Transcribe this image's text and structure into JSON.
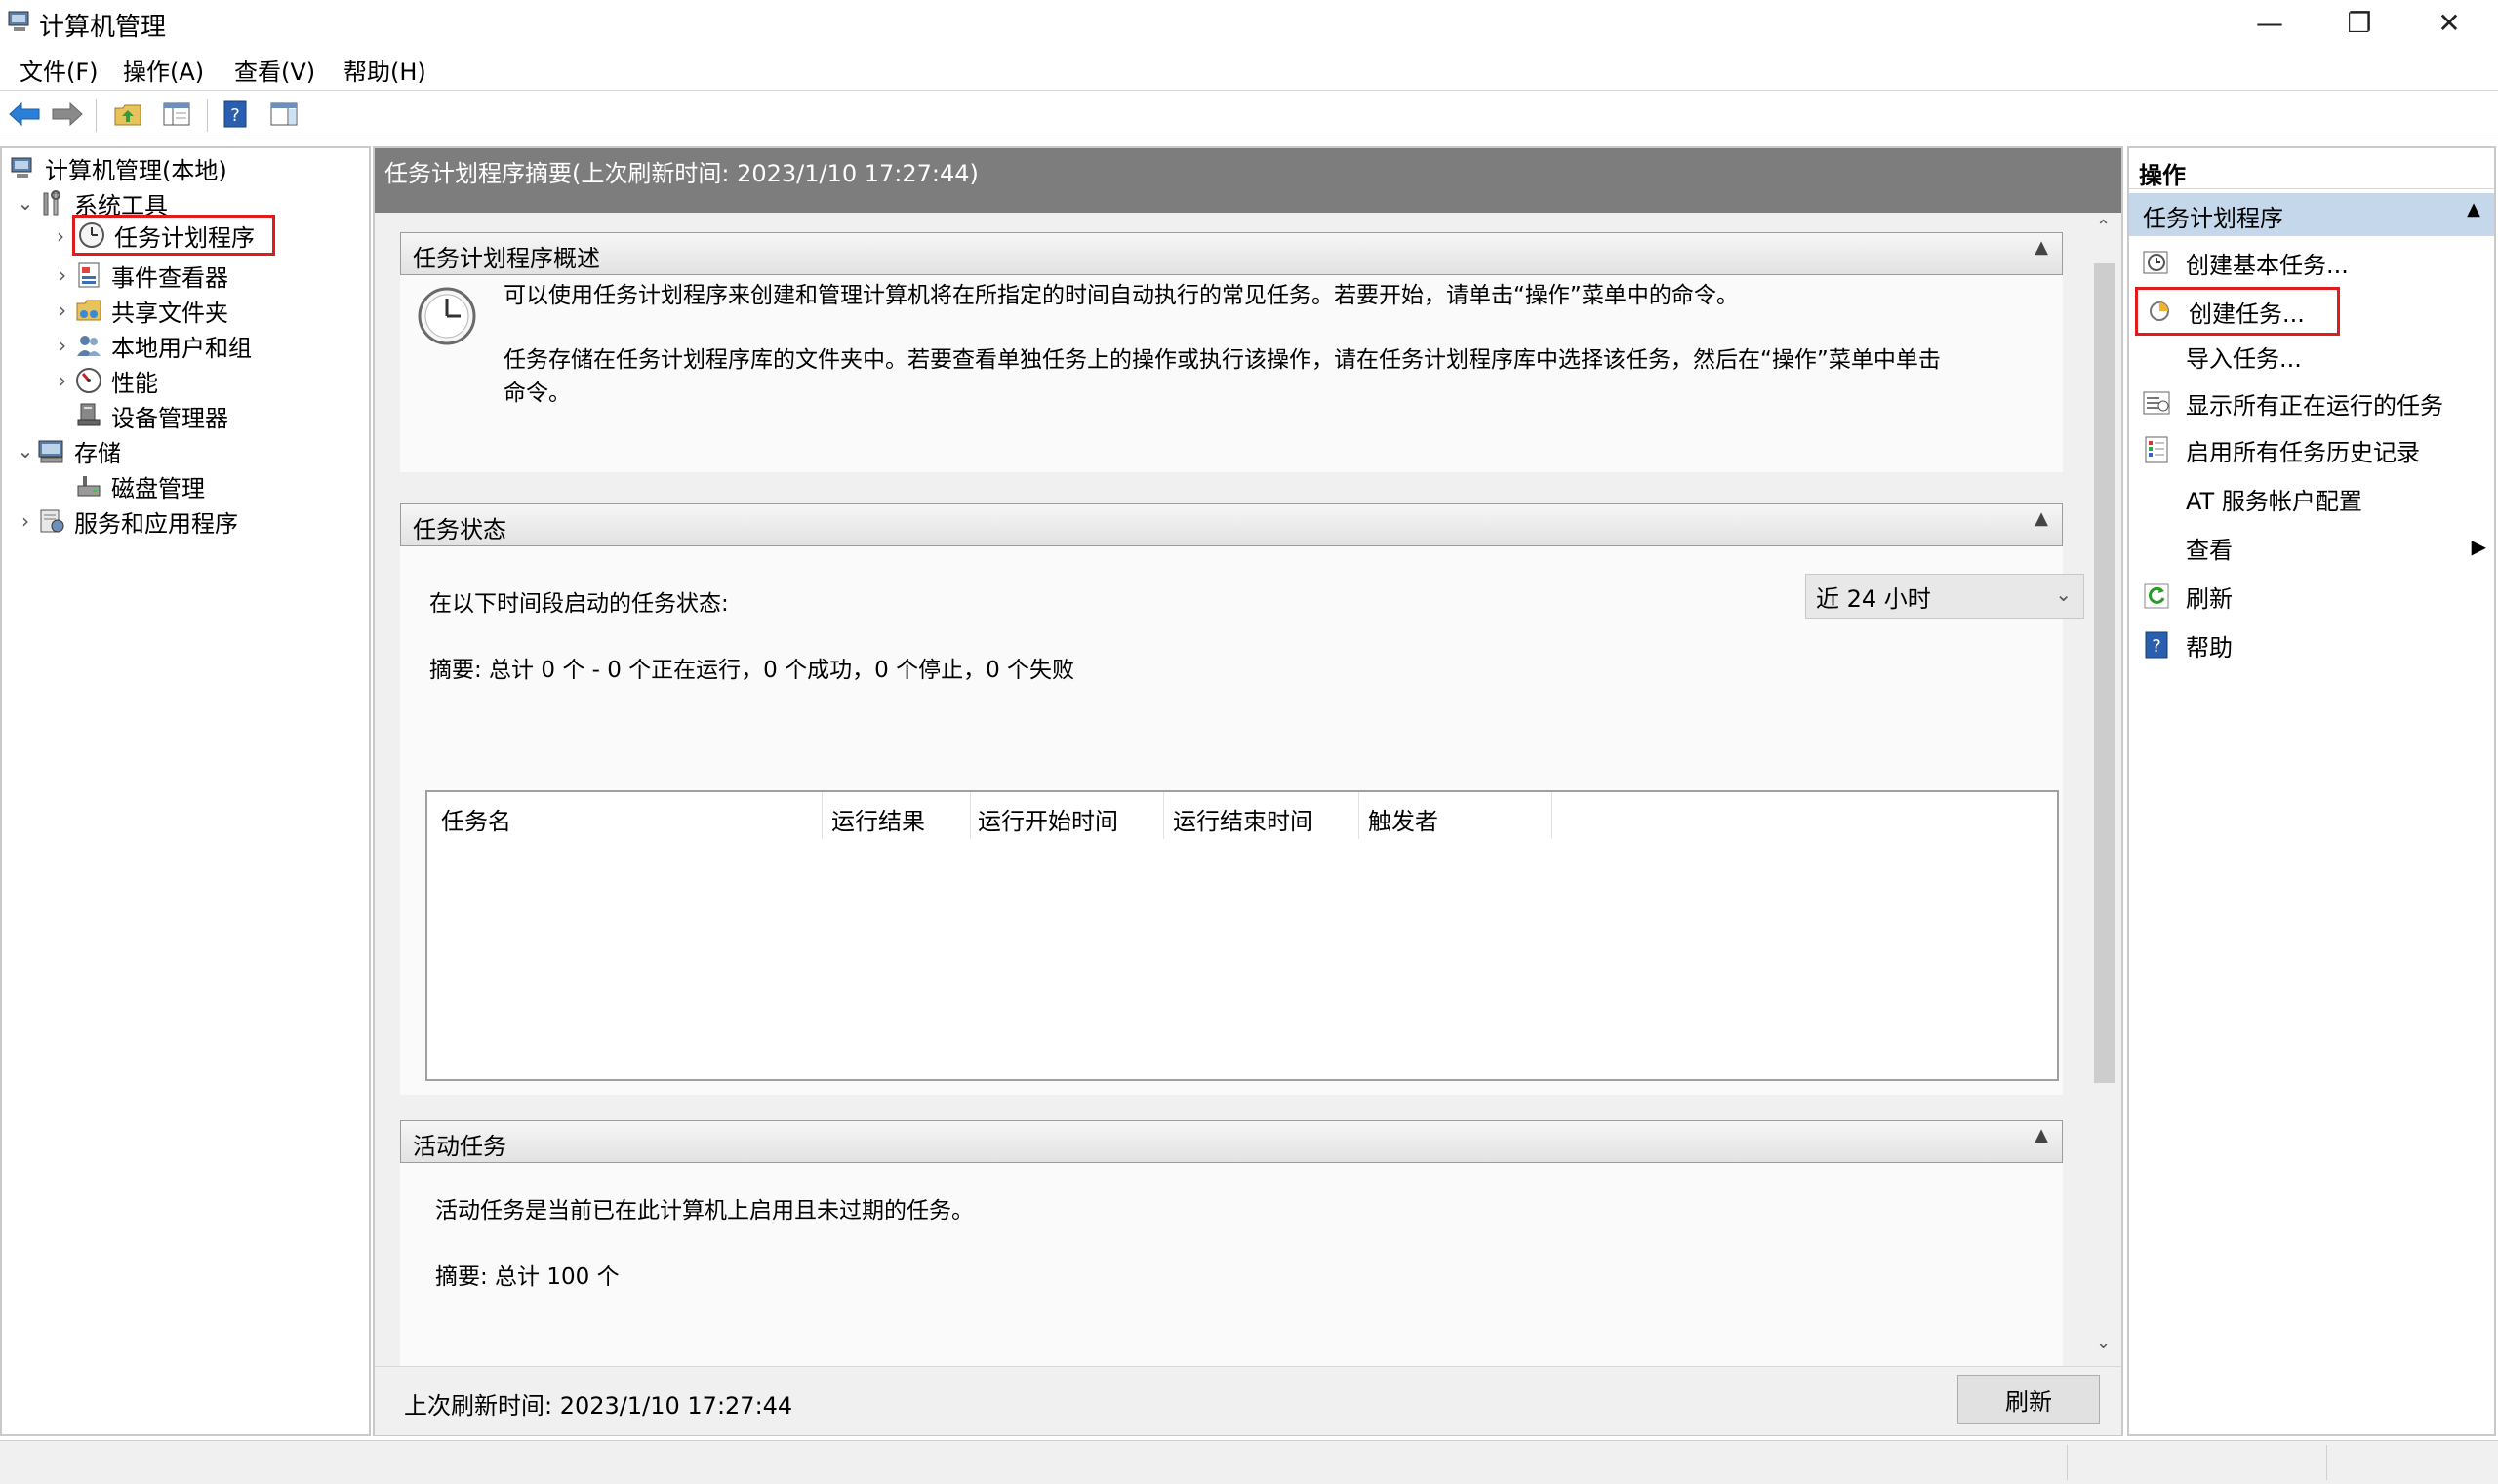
{
  "window": {
    "title": "计算机管理",
    "minimize": "—",
    "restore": "❐",
    "close": "✕"
  },
  "menu": [
    "文件(F)",
    "操作(A)",
    "查看(V)",
    "帮助(H)"
  ],
  "tree": {
    "root": "计算机管理(本地)",
    "system_tools": "系统工具",
    "task_scheduler": "任务计划程序",
    "event_viewer": "事件查看器",
    "shared_folders": "共享文件夹",
    "local_users": "本地用户和组",
    "performance": "性能",
    "device_manager": "设备管理器",
    "storage": "存储",
    "disk_management": "磁盘管理",
    "services_apps": "服务和应用程序"
  },
  "center": {
    "header": "任务计划程序摘要(上次刷新时间: 2023/1/10 17:27:44)",
    "overview": {
      "title": "任务计划程序概述",
      "text1": "可以使用任务计划程序来创建和管理计算机将在所指定的时间自动执行的常见任务。若要开始，请单击“操作”菜单中的命令。",
      "text2a": "任务存储在任务计划程序库的文件夹中。若要查看单独任务上的操作或执行该操作，请在任务计划程序库中选择该任务，然后在“操作”菜单中单击",
      "text2b": "命令。"
    },
    "status": {
      "title": "任务状态",
      "period_label": "在以下时间段启动的任务状态:",
      "period_value": "近 24 小时",
      "summary": "摘要: 总计 0 个 - 0 个正在运行，0 个成功，0 个停止，0 个失败",
      "columns": [
        "任务名",
        "运行结果",
        "运行开始时间",
        "运行结束时间",
        "触发者"
      ]
    },
    "active": {
      "title": "活动任务",
      "text": "活动任务是当前已在此计算机上启用且未过期的任务。",
      "summary": "摘要: 总计 100 个"
    },
    "footer": {
      "last_refresh": "上次刷新时间: 2023/1/10 17:27:44",
      "refresh_button": "刷新"
    }
  },
  "actions": {
    "header": "操作",
    "section": "任务计划程序",
    "items": [
      "创建基本任务...",
      "创建任务...",
      "导入任务...",
      "显示所有正在运行的任务",
      "启用所有任务历史记录",
      "AT 服务帐户配置",
      "查看",
      "刷新",
      "帮助"
    ]
  },
  "colors": {
    "highlight_box": "#e01b1b",
    "section_bar": "#7d7d7d",
    "actions_section": "#c5d7ea"
  }
}
